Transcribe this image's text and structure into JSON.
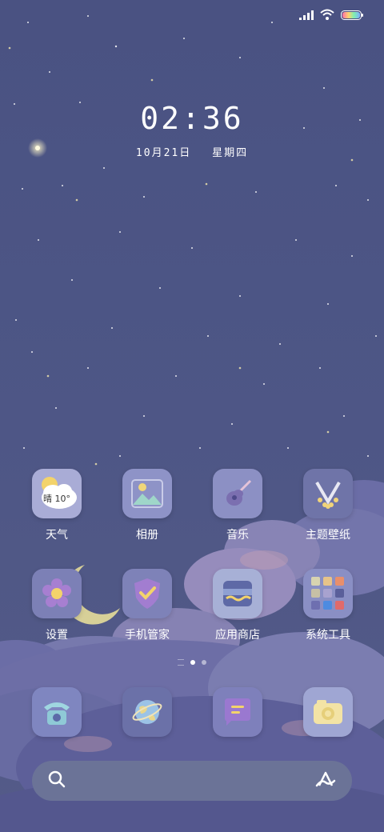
{
  "status_bar": {
    "signal_icon": "signal-bars-icon",
    "wifi_icon": "wifi-icon",
    "battery_icon": "battery-icon"
  },
  "clock": {
    "time": "02:36",
    "date": "10月21日",
    "weekday": "星期四"
  },
  "apps": [
    {
      "id": "weather",
      "label": "天气",
      "icon": "weather-icon",
      "tile_text": "晴 10°"
    },
    {
      "id": "gallery",
      "label": "相册",
      "icon": "gallery-icon"
    },
    {
      "id": "music",
      "label": "音乐",
      "icon": "guitar-icon"
    },
    {
      "id": "themes",
      "label": "主题壁纸",
      "icon": "theme-icon"
    },
    {
      "id": "settings",
      "label": "设置",
      "icon": "gear-flower-icon"
    },
    {
      "id": "security",
      "label": "手机管家",
      "icon": "shield-check-icon"
    },
    {
      "id": "appstore",
      "label": "应用商店",
      "icon": "store-icon"
    },
    {
      "id": "tools",
      "label": "系统工具",
      "icon": "folder-icon"
    }
  ],
  "dock": [
    {
      "id": "phone",
      "icon": "phone-icon"
    },
    {
      "id": "browser",
      "icon": "globe-icon"
    },
    {
      "id": "messages",
      "icon": "message-icon"
    },
    {
      "id": "camera",
      "icon": "camera-icon"
    }
  ],
  "search": {
    "search_icon": "search-icon",
    "assistant_icon": "assistant-icon"
  },
  "colors": {
    "background": "#4c5585",
    "tile": "#8a8fc0",
    "search_bar": "#6b7397"
  }
}
